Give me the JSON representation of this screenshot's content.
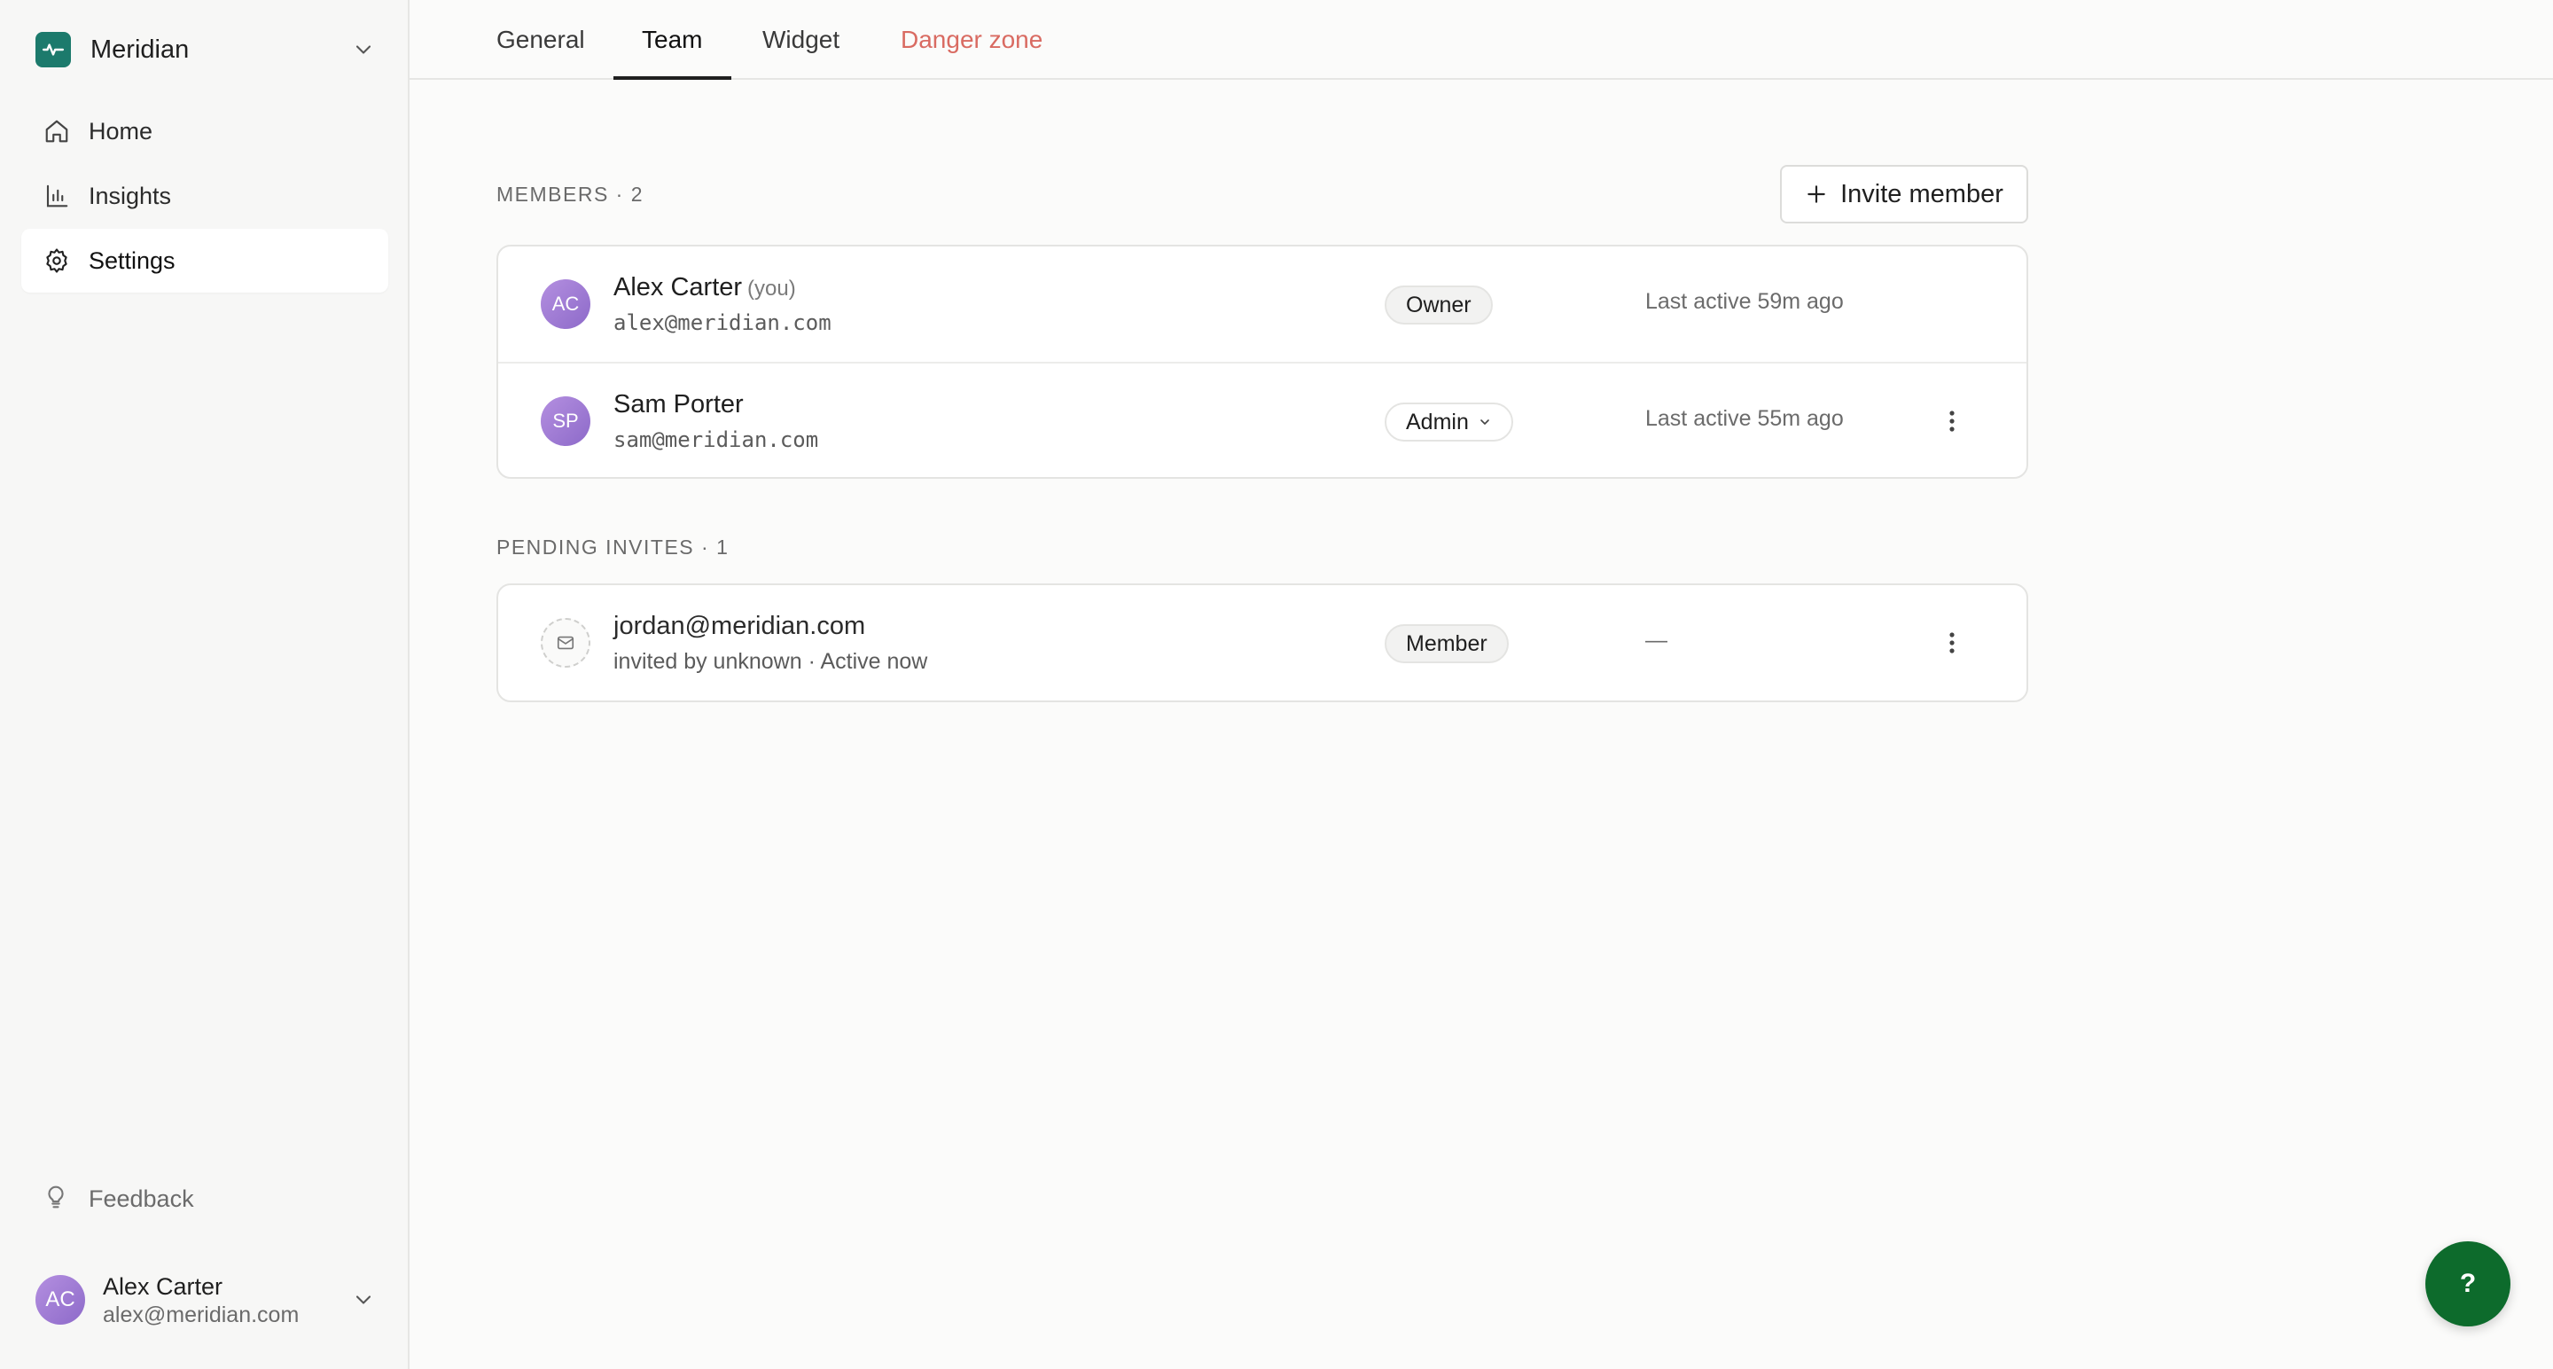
{
  "workspace": {
    "name": "Meridian",
    "icon": "pulse-icon",
    "accent": "#1c7a6c"
  },
  "sidebar": {
    "items": [
      {
        "label": "Home",
        "icon": "home-icon"
      },
      {
        "label": "Insights",
        "icon": "bar-chart-icon"
      },
      {
        "label": "Settings",
        "icon": "gear-icon",
        "active": true
      }
    ],
    "feedback_label": "Feedback",
    "user": {
      "initials": "AC",
      "name": "Alex Carter",
      "email": "alex@meridian.com"
    }
  },
  "tabs": [
    {
      "label": "General"
    },
    {
      "label": "Team",
      "active": true
    },
    {
      "label": "Widget"
    },
    {
      "label": "Danger zone",
      "color": "#d96b62"
    }
  ],
  "members": {
    "heading": "MEMBERS · 2",
    "invite_button": "Invite member",
    "rows": [
      {
        "initials": "AC",
        "name": "Alex Carter",
        "you": "(you)",
        "email": "alex@meridian.com",
        "role": "Owner",
        "activity": "Last active 59m ago"
      },
      {
        "initials": "SP",
        "name": "Sam Porter",
        "email": "sam@meridian.com",
        "role": "Admin",
        "activity": "Last active 55m ago"
      }
    ]
  },
  "pending": {
    "heading": "PENDING INVITES · 1",
    "rows": [
      {
        "email": "jordan@meridian.com",
        "meta": "invited by unknown · Active now",
        "role": "Member",
        "activity": "—"
      }
    ]
  },
  "help_button": "?",
  "colors": {
    "avatar": "#a07ed6",
    "help": "#0d6b2c",
    "danger": "#d96b62"
  }
}
